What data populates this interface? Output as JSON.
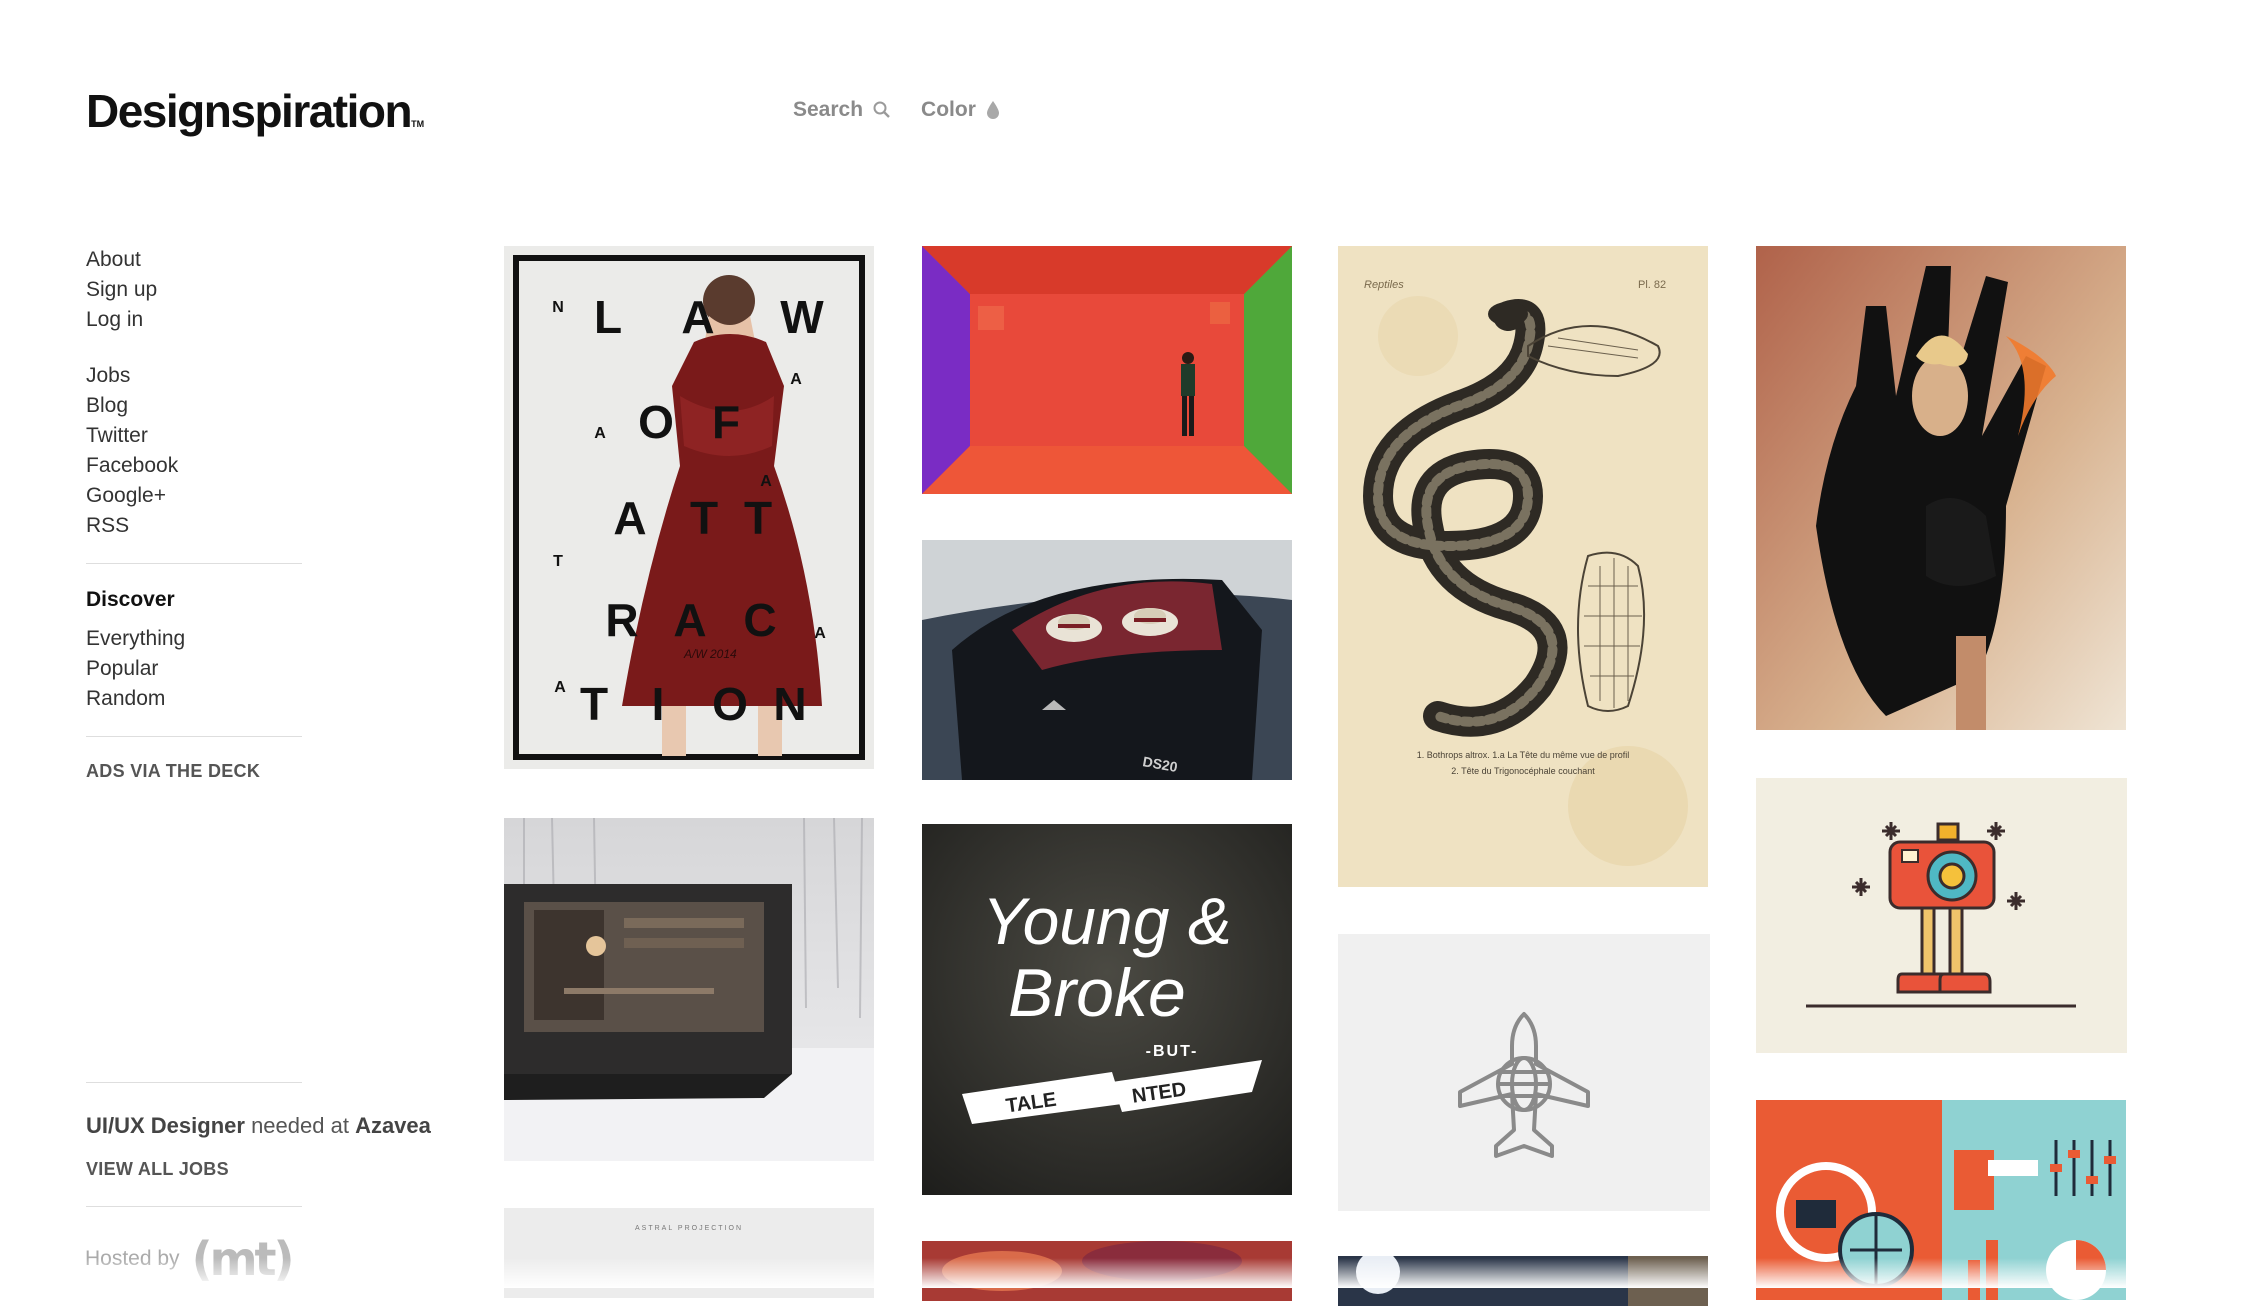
{
  "logo": {
    "text": "Designspiration",
    "tm": "TM"
  },
  "topnav": {
    "search_label": "Search",
    "color_label": "Color"
  },
  "sidebar": {
    "group1": [
      "About",
      "Sign up",
      "Log in"
    ],
    "group2": [
      "Jobs",
      "Blog",
      "Twitter",
      "Facebook",
      "Google+",
      "RSS"
    ],
    "discover_heading": "Discover",
    "discover": [
      "Everything",
      "Popular",
      "Random"
    ],
    "ads": "ADS VIA THE DECK"
  },
  "jobs": {
    "title": "UI/UX Designer",
    "middle": "needed at",
    "company": "Azavea",
    "view_all": "VIEW ALL JOBS"
  },
  "hosted": {
    "label": "Hosted by",
    "logo": "(mt)"
  },
  "tiles": {
    "poster": {
      "big": [
        "L",
        "A",
        "W",
        "O",
        "F",
        "A",
        "T",
        "T",
        "R",
        "A",
        "C",
        "T",
        "I",
        "O",
        "N"
      ],
      "small": [
        "N",
        "A",
        "A",
        "A",
        "T",
        "A",
        "A"
      ],
      "season": "A/W 2014"
    },
    "car": {
      "plate": "DS20"
    },
    "typography": {
      "line1": "Young &",
      "line2": "Broke",
      "but": "-BUT-",
      "banner1": "TALE",
      "banner2": "NTED"
    },
    "snake": {
      "header_left": "Reptiles",
      "header_right": "Pl. 82",
      "cap1": "1. Bothrops altrox.   1.a La Tête du même vue de profil",
      "cap2": "2. Tête du Trigonocéphale couchant"
    },
    "astral": {
      "text": "ASTRAL PROJECTION"
    }
  },
  "colors": {
    "accent": "#111111",
    "muted": "#8a8a8a",
    "rule": "#dedede"
  }
}
